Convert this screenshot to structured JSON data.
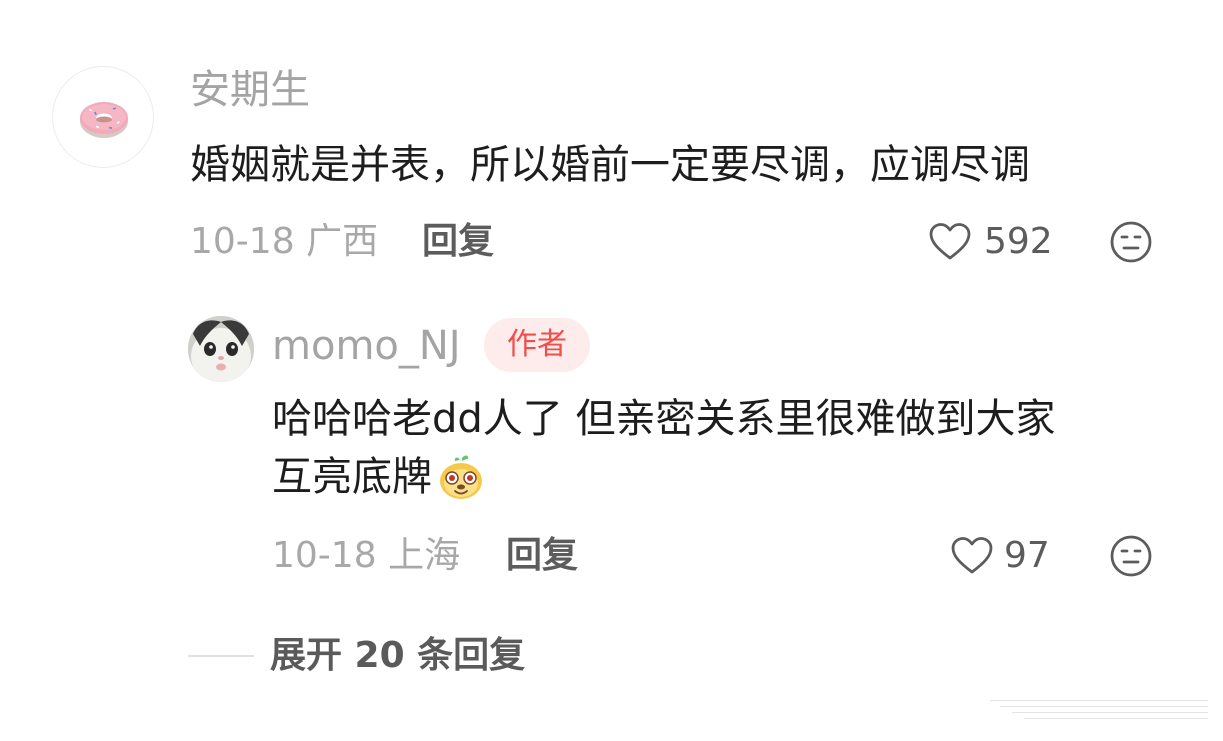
{
  "comment": {
    "username": "安期生",
    "text": "婚姻就是并表，所以婚前一定要尽调，应调尽调",
    "date": "10-18",
    "location": "广西",
    "reply_label": "回复",
    "likes": "592"
  },
  "reply": {
    "username": "momo_NJ",
    "badge": "作者",
    "text_line1": "哈哈哈老dd人了 但亲密关系里很难做到大家",
    "text_line2": "互亮底牌",
    "emoji": "smiling-dog-emoji",
    "date": "10-18",
    "location": "上海",
    "reply_label": "回复",
    "likes": "97"
  },
  "expand": {
    "label": "展开 20 条回复"
  },
  "colors": {
    "username": "#a4a4a4",
    "text": "#1d1d1d",
    "meta": "#a8a8a8",
    "badge_bg": "#fdeceb",
    "badge_text": "#ef4e4a"
  }
}
